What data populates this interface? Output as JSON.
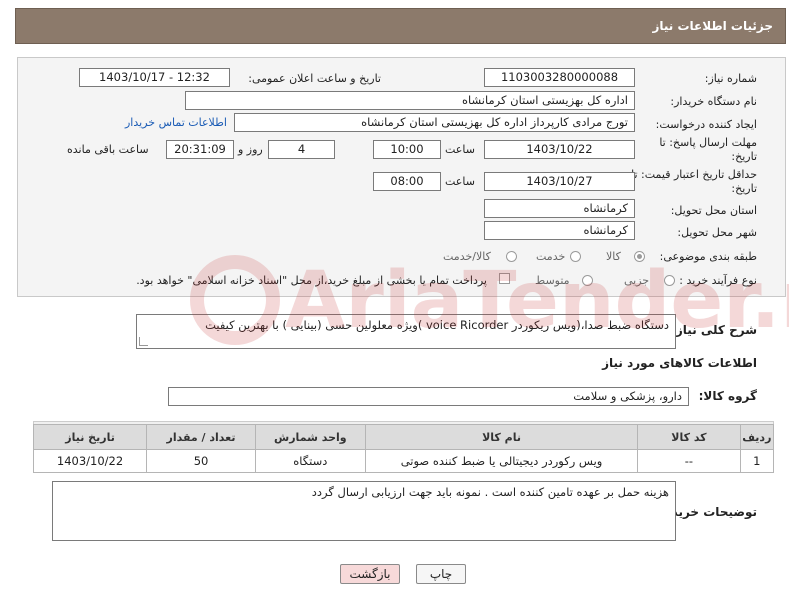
{
  "header": {
    "title": "جزئیات اطلاعات نیاز"
  },
  "form": {
    "need_number_label": "شماره نیاز:",
    "need_number": "1103003280000088",
    "announce_label": "تاریخ و ساعت اعلان عمومی:",
    "announce_value": "1403/10/17 - 12:32",
    "buyer_label": "نام دستگاه خریدار:",
    "buyer_value": "اداره کل بهزیستی استان کرمانشاه",
    "creator_label": "ایجاد کننده درخواست:",
    "creator_value": "تورج مرادی کارپرداز  اداره کل بهزیستی استان کرمانشاه",
    "contact_link": "اطلاعات تماس خریدار",
    "deadline_label": "مهلت ارسال پاسخ: تا تاریخ:",
    "deadline_date": "1403/10/22",
    "time_label": "ساعت",
    "deadline_time": "10:00",
    "days_value": "4",
    "days_label": "روز و",
    "remaining_time": "20:31:09",
    "remaining_label": "ساعت باقی مانده",
    "validity_label": "حداقل تاریخ اعتبار قیمت: تا تاریخ:",
    "validity_date": "1403/10/27",
    "validity_time_label": "ساعت",
    "validity_time": "08:00",
    "province_label": "استان محل تحویل:",
    "province_value": "کرمانشاه",
    "city_label": "شهر محل تحویل:",
    "city_value": "کرمانشاه",
    "category_label": "طبقه بندی موضوعی:",
    "category_options": [
      "کالا",
      "خدمت",
      "کالا/خدمت"
    ],
    "category_selected": "کالا",
    "process_label": "نوع فرآیند خرید :",
    "process_options": [
      "جزیی",
      "متوسط"
    ],
    "process_note": "پرداخت تمام یا بخشی از مبلغ خرید،از محل \"اسناد خزانه اسلامی\" خواهد بود."
  },
  "description": {
    "label": "شرح کلی نیاز:",
    "text": "دستگاه ضبط صدا،(ویس ریکوردر voice Ricorder )ویژه معلولین حسی (بینایی ) با بهترین کیفیت"
  },
  "goods": {
    "section_title": "اطلاعات کالاهای مورد نیاز",
    "group_label": "گروه کالا:",
    "group_value": "دارو، پزشکی و سلامت",
    "columns": [
      "ردیف",
      "کد کالا",
      "نام کالا",
      "واحد شمارش",
      "تعداد / مقدار",
      "تاریخ نیاز"
    ],
    "rows": [
      [
        "1",
        "--",
        "ویس رکوردر دیجیتالی یا ضبط کننده صوتی",
        "دستگاه",
        "50",
        "1403/10/22"
      ]
    ]
  },
  "buyer_notes": {
    "label": "توضیحات خریدار:",
    "text": "هزینه حمل بر عهده تامین کننده است . نمونه باید جهت ارزیابی ارسال گردد"
  },
  "buttons": {
    "print": "چاپ",
    "back": "بازگشت"
  },
  "watermark": {
    "text": "AriaTender.net"
  },
  "colors": {
    "header_bg": "#8c7a6b",
    "link": "#1a5bb5",
    "back_button_bg": "#f7d9d9"
  }
}
